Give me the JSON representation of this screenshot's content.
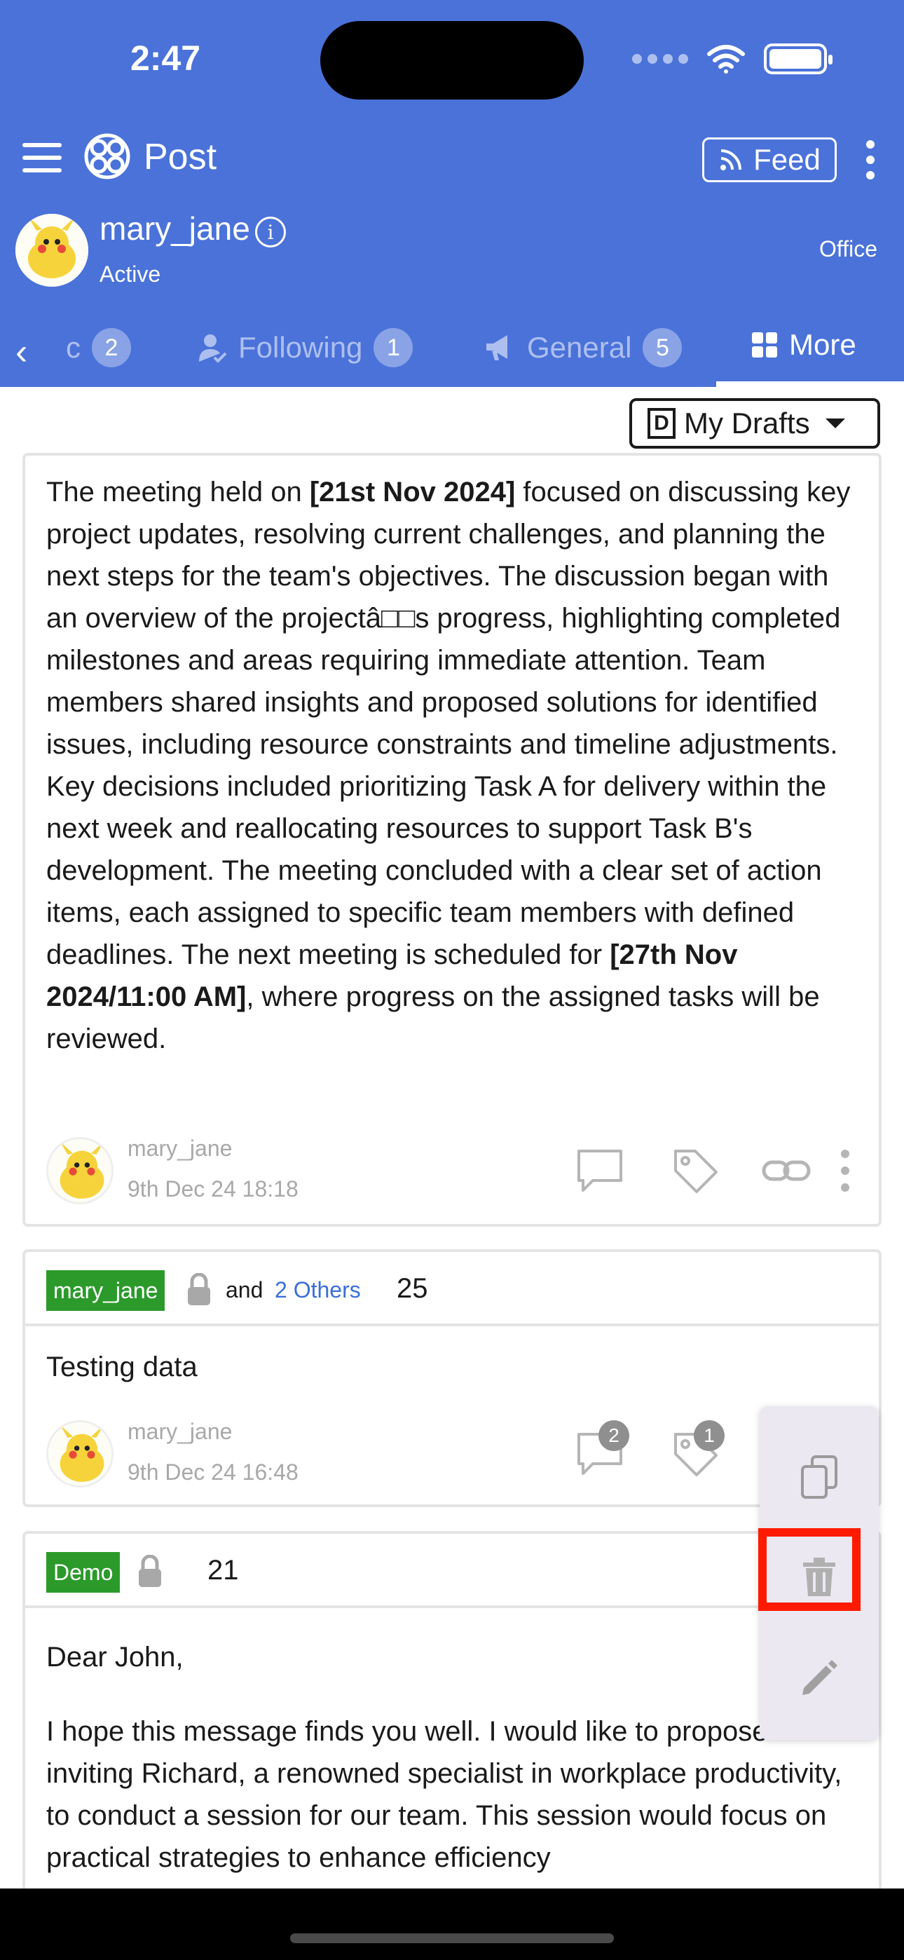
{
  "status_bar": {
    "time": "2:47"
  },
  "app_bar": {
    "title": "Post",
    "feed_label": "Feed"
  },
  "user": {
    "name": "mary_jane",
    "status": "Active",
    "location": "Office"
  },
  "tabs": [
    {
      "label": "c",
      "count": "2"
    },
    {
      "label": "Following",
      "count": "1"
    },
    {
      "label": "General",
      "count": "5"
    },
    {
      "label": "More",
      "active": true
    }
  ],
  "drafts_dropdown": {
    "icon_letter": "D",
    "label": "My Drafts"
  },
  "posts": [
    {
      "body": [
        "The meeting held on ",
        "[21st Nov 2024]",
        " focused on discussing key project updates, resolving current challenges, and planning the next steps for the team's objectives. The discussion began with an overview of the projectâ□□s progress, highlighting completed milestones and areas requiring immediate attention. Team members shared insights and proposed solutions for identified issues, including resource constraints and timeline adjustments. Key decisions included prioritizing Task A for delivery within the next week and reallocating resources to support Task B's development. The meeting concluded with a clear set of action items, each assigned to specific team members with defined deadlines. The next meeting is scheduled for ",
        "[27th Nov 2024/11:00 AM]",
        ", where progress on the assigned tasks will be reviewed."
      ],
      "author": "mary_jane",
      "date": "9th Dec 24 18:18"
    },
    {
      "tag": "mary_jane",
      "and_text": "and",
      "others": "2 Others",
      "number": "25",
      "body": "Testing data",
      "author": "mary_jane",
      "date": "9th Dec 24 16:48",
      "comment_count": "2",
      "tag_count": "1"
    },
    {
      "tag": "Demo",
      "number": "21",
      "greeting": "Dear John,",
      "body": "I hope this message finds you well. I would like to propose inviting Richard, a renowned specialist in workplace productivity, to conduct a session for our team. This session would focus on practical strategies to enhance efficiency"
    }
  ],
  "floating_menu": [
    "copy-icon",
    "trash-icon",
    "pencil-icon"
  ],
  "colors": {
    "header": "#4a72d9",
    "tag": "#2b9a2b",
    "highlight": "#ff1a00",
    "link": "#3a6fd8"
  }
}
